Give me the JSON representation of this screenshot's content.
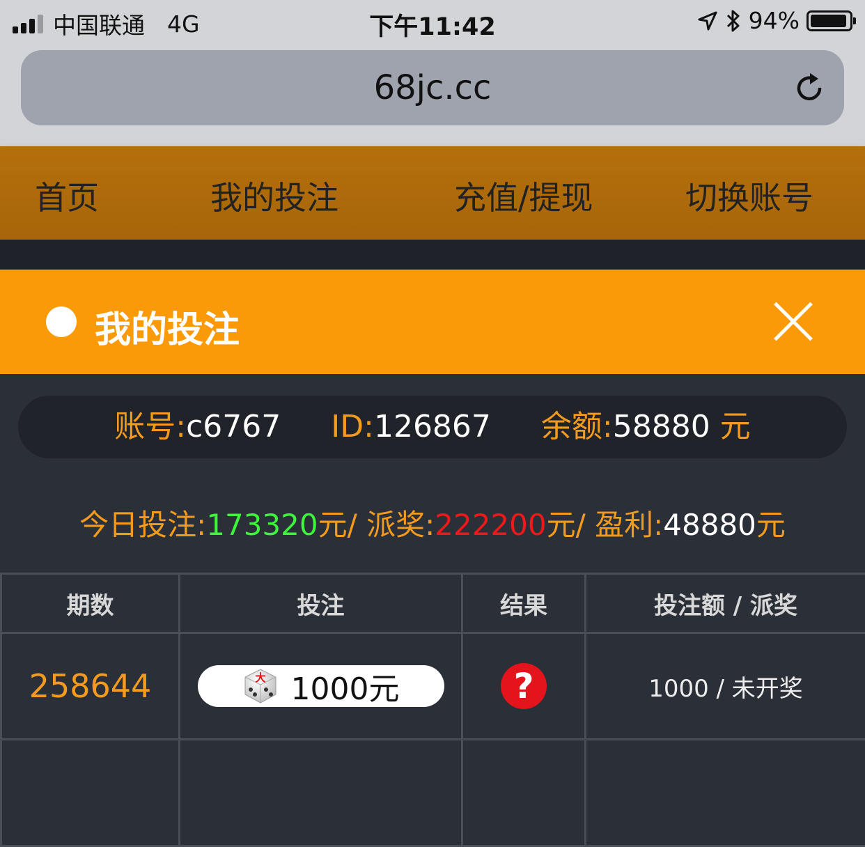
{
  "status_bar": {
    "carrier": "中国联通",
    "network": "4G",
    "time": "下午11:42",
    "battery": "94%",
    "battery_level": 0.94,
    "icons": [
      "signal-icon",
      "location-arrow-icon",
      "bluetooth-icon",
      "battery-icon"
    ]
  },
  "browser": {
    "url": "68jc.cc",
    "reload_icon": "reload-icon"
  },
  "nav": {
    "items": [
      "首页",
      "我的投注",
      "充值/提现",
      "切换账号"
    ]
  },
  "modal": {
    "title": "我的投注",
    "close_icon": "close-icon"
  },
  "account": {
    "account_label": "账号:",
    "account_value": "c6767",
    "id_label": "ID:",
    "id_value": "126867",
    "balance_label": "余额:",
    "balance_value": "58880",
    "balance_unit": " 元"
  },
  "today": {
    "bet_label": "今日投注:",
    "bet_value": "173320",
    "bet_suffix": "元/ ",
    "payout_label": "派奖:",
    "payout_value": "222200",
    "payout_suffix": "元/ ",
    "profit_label": "盈利:",
    "profit_value": "48880",
    "profit_suffix": "元"
  },
  "table": {
    "headers": [
      "期数",
      "投注",
      "结果",
      "投注额 / 派奖"
    ],
    "rows": [
      {
        "issue": "258644",
        "bet_icon_text": "大",
        "bet_amount": "1000元",
        "result": "?",
        "amount_payout": "1000 / 未开奖"
      }
    ]
  },
  "colors": {
    "nav_bg": "#b06b0b",
    "modal_header": "#fb9a08",
    "page_bg": "#2b2f38",
    "label_orange": "#f39b1e",
    "green": "#3df53a",
    "red": "#f01818"
  }
}
